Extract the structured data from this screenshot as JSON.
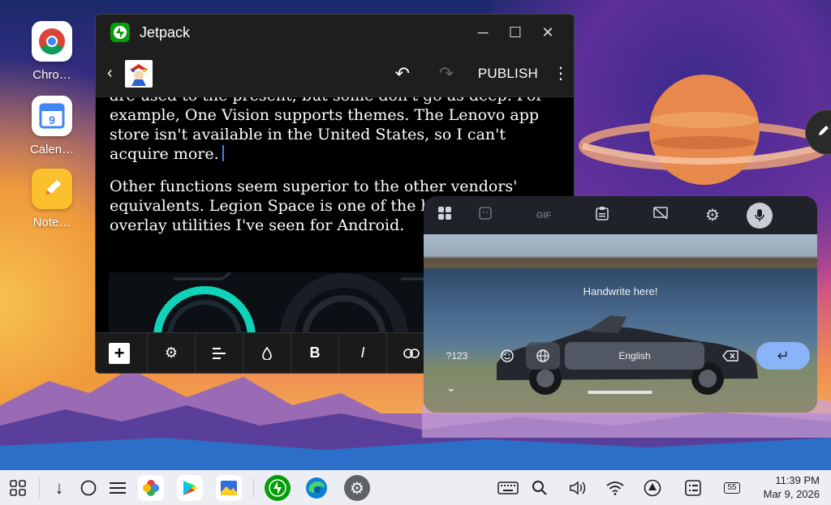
{
  "desktop": {
    "icons": [
      {
        "label": "Chro…",
        "icon": "chrome-icon"
      },
      {
        "label": "Calen…",
        "icon": "calendar-icon",
        "badge": "9"
      },
      {
        "label": "Note…",
        "icon": "notes-icon"
      }
    ]
  },
  "window": {
    "title": "Jetpack",
    "controls": [
      "minimize-icon",
      "maximize-icon",
      "close-icon"
    ],
    "toolbar": {
      "publish_label": "PUBLISH"
    },
    "content": {
      "para1_line0": "are used to the present, but some don't go as deep. For",
      "para1_line1": "example, One Vision supports themes. The Lenovo app",
      "para1_line2": "store isn't available in the United States, so I can't",
      "para1_line3": "acquire more.",
      "para2_line0": "Other functions seem superior to the other vendors'",
      "para2_line1": "equivalents. Legion Space is one of the better",
      "para2_line2": "overlay utilities I've seen for Android."
    },
    "format_bar": {
      "items": [
        "add-block",
        "settings",
        "align",
        "color",
        "B",
        "I",
        "link"
      ]
    }
  },
  "keyboard": {
    "toolbar": [
      "apps-icon",
      "sticker-icon",
      "GIF",
      "clipboard-icon",
      "screenshot-off-icon",
      "gear-icon",
      "mic-icon"
    ],
    "gif_label": "GIF",
    "hint": "Handwrite here!",
    "num_key": "?123",
    "space_label": "English"
  },
  "taskbar": {
    "time": "11:39 PM",
    "date": "Mar 9, 2026",
    "battery": "55",
    "accent": "#8ab4f8"
  }
}
